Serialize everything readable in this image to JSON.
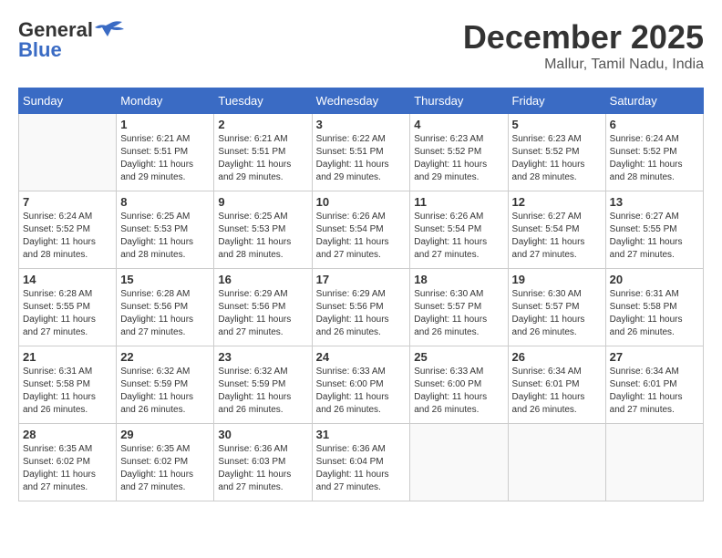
{
  "header": {
    "logo_general": "General",
    "logo_blue": "Blue",
    "month_title": "December 2025",
    "location": "Mallur, Tamil Nadu, India"
  },
  "calendar": {
    "days_of_week": [
      "Sunday",
      "Monday",
      "Tuesday",
      "Wednesday",
      "Thursday",
      "Friday",
      "Saturday"
    ],
    "weeks": [
      [
        {
          "day": "",
          "info": ""
        },
        {
          "day": "1",
          "info": "Sunrise: 6:21 AM\nSunset: 5:51 PM\nDaylight: 11 hours\nand 29 minutes."
        },
        {
          "day": "2",
          "info": "Sunrise: 6:21 AM\nSunset: 5:51 PM\nDaylight: 11 hours\nand 29 minutes."
        },
        {
          "day": "3",
          "info": "Sunrise: 6:22 AM\nSunset: 5:51 PM\nDaylight: 11 hours\nand 29 minutes."
        },
        {
          "day": "4",
          "info": "Sunrise: 6:23 AM\nSunset: 5:52 PM\nDaylight: 11 hours\nand 29 minutes."
        },
        {
          "day": "5",
          "info": "Sunrise: 6:23 AM\nSunset: 5:52 PM\nDaylight: 11 hours\nand 28 minutes."
        },
        {
          "day": "6",
          "info": "Sunrise: 6:24 AM\nSunset: 5:52 PM\nDaylight: 11 hours\nand 28 minutes."
        }
      ],
      [
        {
          "day": "7",
          "info": "Sunrise: 6:24 AM\nSunset: 5:52 PM\nDaylight: 11 hours\nand 28 minutes."
        },
        {
          "day": "8",
          "info": "Sunrise: 6:25 AM\nSunset: 5:53 PM\nDaylight: 11 hours\nand 28 minutes."
        },
        {
          "day": "9",
          "info": "Sunrise: 6:25 AM\nSunset: 5:53 PM\nDaylight: 11 hours\nand 28 minutes."
        },
        {
          "day": "10",
          "info": "Sunrise: 6:26 AM\nSunset: 5:54 PM\nDaylight: 11 hours\nand 27 minutes."
        },
        {
          "day": "11",
          "info": "Sunrise: 6:26 AM\nSunset: 5:54 PM\nDaylight: 11 hours\nand 27 minutes."
        },
        {
          "day": "12",
          "info": "Sunrise: 6:27 AM\nSunset: 5:54 PM\nDaylight: 11 hours\nand 27 minutes."
        },
        {
          "day": "13",
          "info": "Sunrise: 6:27 AM\nSunset: 5:55 PM\nDaylight: 11 hours\nand 27 minutes."
        }
      ],
      [
        {
          "day": "14",
          "info": "Sunrise: 6:28 AM\nSunset: 5:55 PM\nDaylight: 11 hours\nand 27 minutes."
        },
        {
          "day": "15",
          "info": "Sunrise: 6:28 AM\nSunset: 5:56 PM\nDaylight: 11 hours\nand 27 minutes."
        },
        {
          "day": "16",
          "info": "Sunrise: 6:29 AM\nSunset: 5:56 PM\nDaylight: 11 hours\nand 27 minutes."
        },
        {
          "day": "17",
          "info": "Sunrise: 6:29 AM\nSunset: 5:56 PM\nDaylight: 11 hours\nand 26 minutes."
        },
        {
          "day": "18",
          "info": "Sunrise: 6:30 AM\nSunset: 5:57 PM\nDaylight: 11 hours\nand 26 minutes."
        },
        {
          "day": "19",
          "info": "Sunrise: 6:30 AM\nSunset: 5:57 PM\nDaylight: 11 hours\nand 26 minutes."
        },
        {
          "day": "20",
          "info": "Sunrise: 6:31 AM\nSunset: 5:58 PM\nDaylight: 11 hours\nand 26 minutes."
        }
      ],
      [
        {
          "day": "21",
          "info": "Sunrise: 6:31 AM\nSunset: 5:58 PM\nDaylight: 11 hours\nand 26 minutes."
        },
        {
          "day": "22",
          "info": "Sunrise: 6:32 AM\nSunset: 5:59 PM\nDaylight: 11 hours\nand 26 minutes."
        },
        {
          "day": "23",
          "info": "Sunrise: 6:32 AM\nSunset: 5:59 PM\nDaylight: 11 hours\nand 26 minutes."
        },
        {
          "day": "24",
          "info": "Sunrise: 6:33 AM\nSunset: 6:00 PM\nDaylight: 11 hours\nand 26 minutes."
        },
        {
          "day": "25",
          "info": "Sunrise: 6:33 AM\nSunset: 6:00 PM\nDaylight: 11 hours\nand 26 minutes."
        },
        {
          "day": "26",
          "info": "Sunrise: 6:34 AM\nSunset: 6:01 PM\nDaylight: 11 hours\nand 26 minutes."
        },
        {
          "day": "27",
          "info": "Sunrise: 6:34 AM\nSunset: 6:01 PM\nDaylight: 11 hours\nand 27 minutes."
        }
      ],
      [
        {
          "day": "28",
          "info": "Sunrise: 6:35 AM\nSunset: 6:02 PM\nDaylight: 11 hours\nand 27 minutes."
        },
        {
          "day": "29",
          "info": "Sunrise: 6:35 AM\nSunset: 6:02 PM\nDaylight: 11 hours\nand 27 minutes."
        },
        {
          "day": "30",
          "info": "Sunrise: 6:36 AM\nSunset: 6:03 PM\nDaylight: 11 hours\nand 27 minutes."
        },
        {
          "day": "31",
          "info": "Sunrise: 6:36 AM\nSunset: 6:04 PM\nDaylight: 11 hours\nand 27 minutes."
        },
        {
          "day": "",
          "info": ""
        },
        {
          "day": "",
          "info": ""
        },
        {
          "day": "",
          "info": ""
        }
      ]
    ]
  }
}
